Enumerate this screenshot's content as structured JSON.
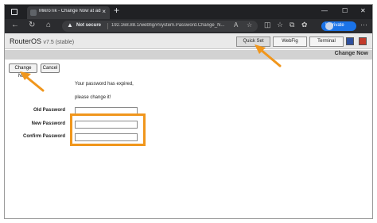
{
  "browser": {
    "tab_title": "MikroTik - Change Now at admin",
    "tab_close": "×",
    "new_tab": "+",
    "win_minimize": "—",
    "win_maximize": "☐",
    "win_close": "✕",
    "not_secure": "Not secure",
    "url": "192.168.88.1/webfig/#System.Password.Change_N...",
    "inprivate": "InPrivate"
  },
  "routeros": {
    "title": "RouterOS",
    "version": "v7.5 (stable)",
    "modes": [
      "Quick Set",
      "WebFig",
      "Terminal"
    ],
    "active_mode": "Quick Set",
    "section_title": "Change Now"
  },
  "form": {
    "change_button": "Change Now",
    "cancel_button": "Cancel",
    "message_line1": "Your password has expired,",
    "message_line2": "please change it!",
    "old_password_label": "Old Password",
    "new_password_label": "New Password",
    "confirm_password_label": "Confirm Password",
    "old_password_value": "",
    "new_password_value": "",
    "confirm_password_value": ""
  },
  "colors": {
    "highlight": "#f0961c",
    "arrow": "#f0961c"
  }
}
